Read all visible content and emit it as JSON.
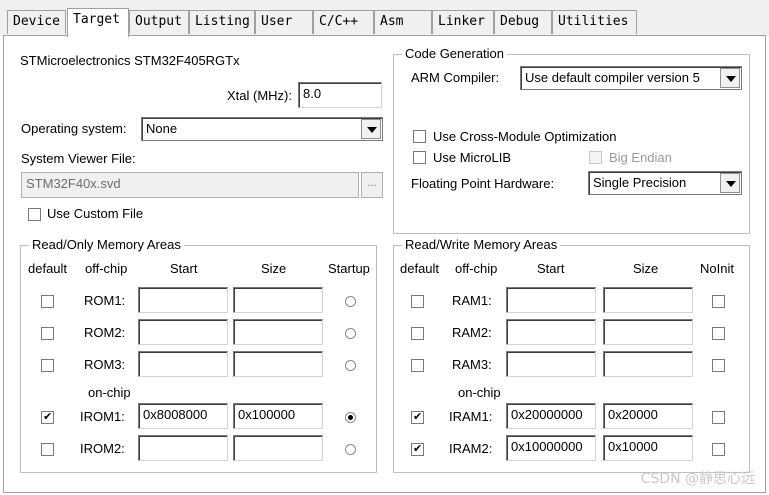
{
  "tabs": [
    "Device",
    "Target",
    "Output",
    "Listing",
    "User",
    "C/C++",
    "Asm",
    "Linker",
    "Debug",
    "Utilities"
  ],
  "active_tab": "Target",
  "device_name": "STMicroelectronics STM32F405RGTx",
  "xtal": {
    "label": "Xtal (MHz):",
    "value": "8.0"
  },
  "os": {
    "label": "Operating system:",
    "value": "None"
  },
  "viewer": {
    "label": "System Viewer File:",
    "value": "STM32F40x.svd",
    "browse": "...",
    "custom_label": "Use Custom File",
    "custom_checked": false
  },
  "codegen": {
    "title": "Code Generation",
    "compiler_label": "ARM Compiler:",
    "compiler_value": "Use default compiler version 5",
    "cross_module": "Use Cross-Module Optimization",
    "microlib": "Use MicroLIB",
    "big_endian": "Big Endian",
    "fph_label": "Floating Point Hardware:",
    "fph_value": "Single Precision"
  },
  "ro": {
    "title": "Read/Only Memory Areas",
    "headers": {
      "default": "default",
      "offchip": "off-chip",
      "start": "Start",
      "size": "Size",
      "last": "Startup"
    },
    "onchip_label": "on-chip",
    "rows": [
      {
        "name": "ROM1:",
        "start": "",
        "size": "",
        "checked": false,
        "selected": false
      },
      {
        "name": "ROM2:",
        "start": "",
        "size": "",
        "checked": false,
        "selected": false
      },
      {
        "name": "ROM3:",
        "start": "",
        "size": "",
        "checked": false,
        "selected": false
      },
      {
        "name": "IROM1:",
        "start": "0x8008000",
        "size": "0x100000",
        "checked": true,
        "selected": true
      },
      {
        "name": "IROM2:",
        "start": "",
        "size": "",
        "checked": false,
        "selected": false
      }
    ]
  },
  "rw": {
    "title": "Read/Write Memory Areas",
    "headers": {
      "default": "default",
      "offchip": "off-chip",
      "start": "Start",
      "size": "Size",
      "last": "NoInit"
    },
    "onchip_label": "on-chip",
    "rows": [
      {
        "name": "RAM1:",
        "start": "",
        "size": "",
        "checked": false,
        "noinit": false
      },
      {
        "name": "RAM2:",
        "start": "",
        "size": "",
        "checked": false,
        "noinit": false
      },
      {
        "name": "RAM3:",
        "start": "",
        "size": "",
        "checked": false,
        "noinit": false
      },
      {
        "name": "IRAM1:",
        "start": "0x20000000",
        "size": "0x20000",
        "checked": true,
        "noinit": false
      },
      {
        "name": "IRAM2:",
        "start": "0x10000000",
        "size": "0x10000",
        "checked": true,
        "noinit": false
      }
    ]
  },
  "watermark": "CSDN @静思心远"
}
